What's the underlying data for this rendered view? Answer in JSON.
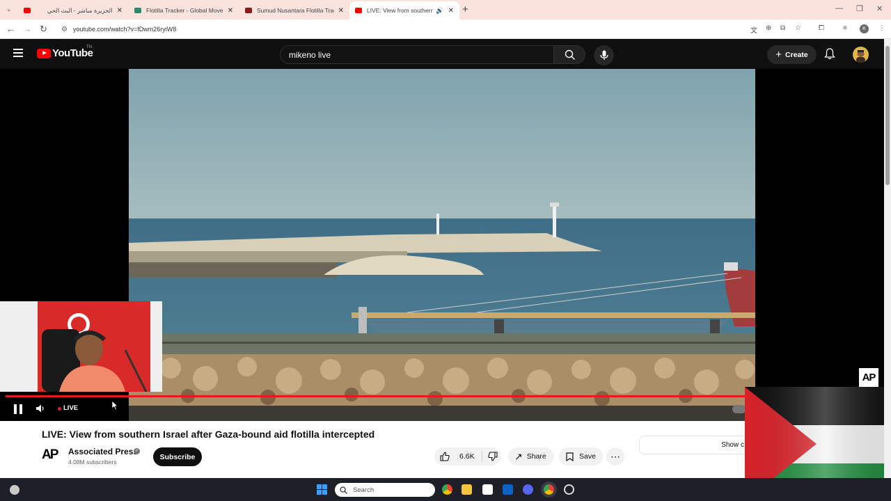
{
  "browser": {
    "tabs": [
      {
        "title": "الجزيرة مباشر - البث الحي",
        "favicon_color": "#ff0000",
        "active": false
      },
      {
        "title": "Flotilla Tracker - Global Moveme",
        "favicon_color": "#2c8a6a",
        "active": false
      },
      {
        "title": "Sumud Nusantara Flotilla Tracki",
        "favicon_color": "#8a1b1b",
        "active": false
      },
      {
        "title": "LIVE: View from southern Is",
        "favicon_color": "#ff0000",
        "active": true
      }
    ],
    "url": "youtube.com/watch?v=fDwm26ryiW8"
  },
  "youtube": {
    "logo_text": "YouTube",
    "logo_tm": "TN",
    "search_value": "mikeno live",
    "create_label": "Create"
  },
  "player": {
    "live_label": "LIVE",
    "watermark": "AP"
  },
  "video_info": {
    "title": "LIVE: View from southern Israel after Gaza-bound aid flotilla intercepted",
    "channel_logo": "AP",
    "channel_name": "Associated Press",
    "subscribers": "4.08M subscribers",
    "subscribe_label": "Subscribe",
    "likes": "6.6K",
    "share_label": "Share",
    "save_label": "Save",
    "show_label": "Show c"
  },
  "taskbar": {
    "search_placeholder": "Search"
  },
  "colors": {
    "accent_red": "#ff0000",
    "dark_bg": "#0f0f0f"
  }
}
